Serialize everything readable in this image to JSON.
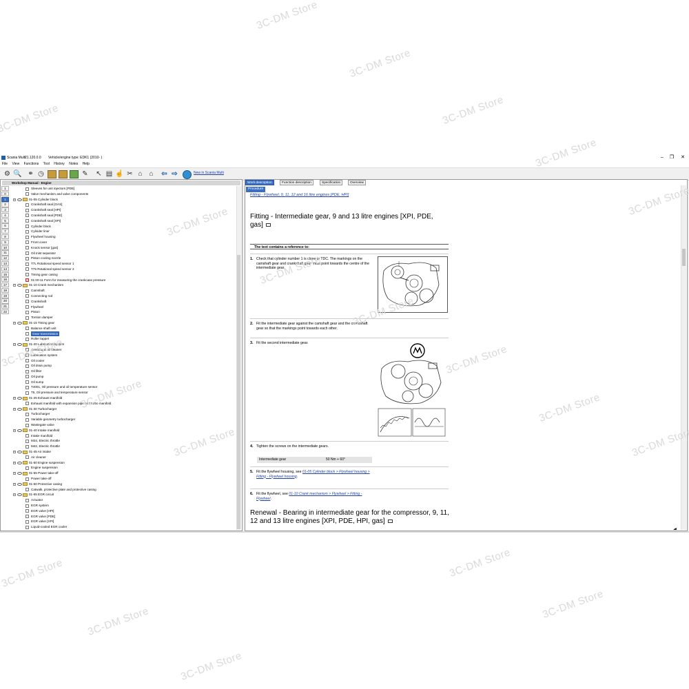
{
  "watermark_text": "3C-DM Store",
  "window": {
    "app_name": "Scania Multi",
    "version": "21.120.0.0",
    "vehicle": "Vehicle/engine type: EDK1 (2010- )",
    "controls": [
      "–",
      "❐",
      "✕"
    ]
  },
  "menu": [
    "File",
    "View",
    "Functions",
    "Tool",
    "History",
    "Notes",
    "Help"
  ],
  "toolbar": {
    "link_text": "New in Scania Multi"
  },
  "left_panel": {
    "header": "Workshop Manual - Engine",
    "numbers": [
      "1",
      "0",
      "1",
      "2",
      "3",
      "4",
      "5",
      "6",
      "7",
      "8",
      "9",
      "10",
      "11",
      "12",
      "13",
      "14",
      "15",
      "16",
      "17",
      "18",
      "19",
      "20",
      "21",
      "22"
    ],
    "selected_number_index": 2,
    "tree": [
      {
        "label": "Sleeves for unit injectors [PDE]",
        "level": 2,
        "type": "doc"
      },
      {
        "label": "Valve mechanism and valve components",
        "level": 2,
        "type": "doc"
      },
      {
        "label": "01-05 Cylinder block",
        "level": 1,
        "type": "group"
      },
      {
        "label": "Crankshaft seal [GAS]",
        "level": 2,
        "type": "doc"
      },
      {
        "label": "Crankshaft seal [HPI]",
        "level": 2,
        "type": "doc"
      },
      {
        "label": "Crankshaft seal [PDE]",
        "level": 2,
        "type": "doc"
      },
      {
        "label": "Crankshaft seal [XPI]",
        "level": 2,
        "type": "doc"
      },
      {
        "label": "Cylinder block",
        "level": 2,
        "type": "doc"
      },
      {
        "label": "Cylinder liner",
        "level": 2,
        "type": "doc"
      },
      {
        "label": "Flywheel housing",
        "level": 2,
        "type": "doc"
      },
      {
        "label": "Front cover",
        "level": 2,
        "type": "doc"
      },
      {
        "label": "Knock sensor [gas]",
        "level": 2,
        "type": "doc"
      },
      {
        "label": "Oil mist separator",
        "level": 2,
        "type": "doc"
      },
      {
        "label": "Piston cooling nozzle",
        "level": 2,
        "type": "doc"
      },
      {
        "label": "T7L Rotational speed sensor 1",
        "level": 2,
        "type": "doc"
      },
      {
        "label": "T75 Rotational speed sensor 2",
        "level": 2,
        "type": "doc"
      },
      {
        "label": "Timing gear casing",
        "level": 2,
        "type": "doc"
      },
      {
        "label": "01:00-11 Form for measuring the crankcase pressure",
        "level": 2,
        "type": "red"
      },
      {
        "label": "01-10 Crank mechanism",
        "level": 1,
        "type": "group"
      },
      {
        "label": "Camshaft",
        "level": 2,
        "type": "doc"
      },
      {
        "label": "Connecting rod",
        "level": 2,
        "type": "doc"
      },
      {
        "label": "Crankshaft",
        "level": 2,
        "type": "doc"
      },
      {
        "label": "Flywheel",
        "level": 2,
        "type": "doc"
      },
      {
        "label": "Piston",
        "level": 2,
        "type": "doc"
      },
      {
        "label": "Torsion damper",
        "level": 2,
        "type": "doc"
      },
      {
        "label": "01-15 Timing gear",
        "level": 1,
        "type": "group"
      },
      {
        "label": "Balance shaft unit",
        "level": 2,
        "type": "doc"
      },
      {
        "label": "Gear transmission",
        "level": 2,
        "type": "doc",
        "highlight": true
      },
      {
        "label": "Roller tappet",
        "level": 2,
        "type": "doc"
      },
      {
        "label": "01-20 Lubrication system",
        "level": 1,
        "type": "group"
      },
      {
        "label": "Centrifugal oil cleaner",
        "level": 2,
        "type": "doc"
      },
      {
        "label": "Lubrication system",
        "level": 2,
        "type": "doc"
      },
      {
        "label": "Oil cooler",
        "level": 2,
        "type": "doc"
      },
      {
        "label": "Oil drain pump",
        "level": 2,
        "type": "doc"
      },
      {
        "label": "Oil filter",
        "level": 2,
        "type": "doc"
      },
      {
        "label": "Oil pump",
        "level": 2,
        "type": "doc"
      },
      {
        "label": "Oil sump",
        "level": 2,
        "type": "doc"
      },
      {
        "label": "T4001, Oil pressure and oil temperature sensor",
        "level": 2,
        "type": "doc"
      },
      {
        "label": "T5, Oil pressure and temperature sensor",
        "level": 2,
        "type": "doc"
      },
      {
        "label": "01-25 Exhaust manifold",
        "level": 1,
        "type": "group"
      },
      {
        "label": "Exhaust manifold with expansion pipe and turbo manifold",
        "level": 2,
        "type": "doc"
      },
      {
        "label": "01-30 Turbocharger",
        "level": 1,
        "type": "group"
      },
      {
        "label": "Turbocharger",
        "level": 2,
        "type": "doc"
      },
      {
        "label": "Variable geometry turbocharger",
        "level": 2,
        "type": "doc"
      },
      {
        "label": "Wastegate valve",
        "level": 2,
        "type": "doc"
      },
      {
        "label": "01-40 Intake manifold",
        "level": 1,
        "type": "group"
      },
      {
        "label": "Intake manifold",
        "level": 2,
        "type": "doc"
      },
      {
        "label": "M34, Electric throttle",
        "level": 2,
        "type": "doc"
      },
      {
        "label": "M42, Electric throttle",
        "level": 2,
        "type": "doc"
      },
      {
        "label": "01-45 Air intake",
        "level": 1,
        "type": "group"
      },
      {
        "label": "Air cleaner",
        "level": 2,
        "type": "doc"
      },
      {
        "label": "01-50 Engine suspension",
        "level": 1,
        "type": "group"
      },
      {
        "label": "Engine suspension",
        "level": 2,
        "type": "doc"
      },
      {
        "label": "01-55 Power take-off",
        "level": 1,
        "type": "group"
      },
      {
        "label": "Power take-off",
        "level": 2,
        "type": "doc"
      },
      {
        "label": "01-60 Protective casing",
        "level": 1,
        "type": "group"
      },
      {
        "label": "Catwalk, protective plate and protective casing",
        "level": 2,
        "type": "doc"
      },
      {
        "label": "01-65 EGR circuit",
        "level": 1,
        "type": "group"
      },
      {
        "label": "Actuator",
        "level": 2,
        "type": "doc"
      },
      {
        "label": "EGR system",
        "level": 2,
        "type": "doc"
      },
      {
        "label": "EGR valve [HPI]",
        "level": 2,
        "type": "doc"
      },
      {
        "label": "EGR valve [PDE]",
        "level": 2,
        "type": "doc"
      },
      {
        "label": "EGR valve [XPI]",
        "level": 2,
        "type": "doc"
      },
      {
        "label": "Liquid-cooled EGR cooler",
        "level": 2,
        "type": "doc"
      }
    ]
  },
  "right_panel": {
    "tabs": [
      "Work description",
      "Function description",
      "Specification",
      "Overview"
    ],
    "active_tab_index": 0,
    "subtab": "Procedure",
    "top_link": "Fitting - Flywheel, 9, 11, 12 and 16 litre engines [PDE, HPI]",
    "section_title": "Fitting - Intermediate gear, 9 and 13 litre engines [XPI, PDE, gas]",
    "reference_note": "The text contains a reference to:",
    "steps": [
      {
        "num": "1.",
        "text": "Check that cylinder number 1 is close to TDC. The markings on the camshaft gear and crankshaft gear must point towards the centre of the intermediate gear."
      },
      {
        "num": "2.",
        "text": "Fit the intermediate gear against the camshaft gear and the crankshaft gear so that the markings point towards each other."
      },
      {
        "num": "3.",
        "text": "Fit the second intermediate gear."
      },
      {
        "num": "4.",
        "text": "Tighten the screws on the intermediate gears.",
        "spec_label": "Intermediate gear",
        "spec_value": "50 Nm + 60°"
      },
      {
        "num": "5.",
        "text": "Fit the flywheel housing, see ",
        "link": "01-05 Cylinder block > Flywheel housing > Fitting - Flywheel housing",
        "after": "."
      },
      {
        "num": "6.",
        "text": "Fit the flywheel, see ",
        "link": "01-10 Crank mechanism > Flywheel > Fitting - Flywheel",
        "after": "."
      }
    ],
    "next_title": "Renewal - Bearing in intermediate gear for the compressor, 9, 11, 12 and 13 litre engines [XPI, PDE, HPI, gas]"
  }
}
